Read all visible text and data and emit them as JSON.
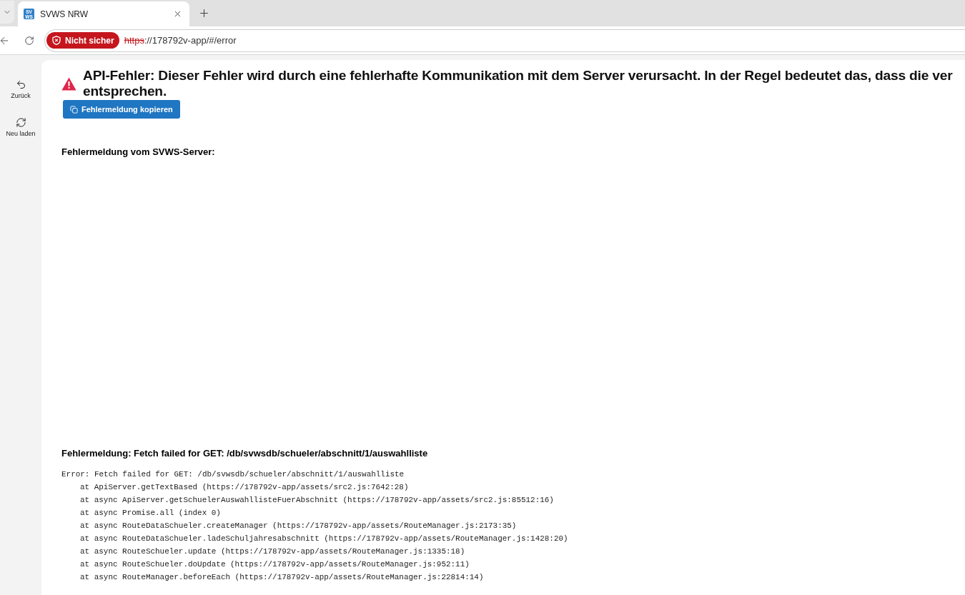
{
  "browser": {
    "tabs": [
      {
        "title": "SVWS NRW",
        "favicon_text": "SV WS",
        "selected": true
      }
    ],
    "address_bar": {
      "security_label": "Nicht sicher",
      "secure": false,
      "scheme": "https",
      "url_rest": "://178792v-app/#/error"
    }
  },
  "sidebar": {
    "items": [
      {
        "kind": "back",
        "label": "Zurück"
      },
      {
        "kind": "reload",
        "label": "Neu laden"
      }
    ]
  },
  "error_page": {
    "heading_lines": [
      "API-Fehler: Dieser Fehler wird durch eine fehlerhafte Kommunikation mit dem Server verursacht. In der Regel bedeutet das, dass die ver",
      "entsprechen."
    ],
    "copy_button": "Fehlermeldung kopieren",
    "server_message_title": "Fehlermeldung vom SVWS-Server:",
    "message_title": "Fehlermeldung: Fetch failed for GET: /db/svwsdb/schueler/abschnitt/1/auswahlliste",
    "stack": {
      "message": "Error: Fetch failed for GET: /db/svwsdb/schueler/abschnitt/1/auswahlliste",
      "frames": [
        "at ApiServer.getTextBased (https://178792v-app/assets/src2.js:7642:28)",
        "at async ApiServer.getSchuelerAuswahllisteFuerAbschnitt (https://178792v-app/assets/src2.js:85512:16)",
        "at async Promise.all (index 0)",
        "at async RouteDataSchueler.createManager (https://178792v-app/assets/RouteManager.js:2173:35)",
        "at async RouteDataSchueler.ladeSchuljahresabschnitt (https://178792v-app/assets/RouteManager.js:1428:20)",
        "at async RouteSchueler.update (https://178792v-app/assets/RouteManager.js:1335:18)",
        "at async RouteSchueler.doUpdate (https://178792v-app/assets/RouteManager.js:952:11)",
        "at async RouteManager.beforeEach (https://178792v-app/assets/RouteManager.js:22814:14)"
      ]
    }
  }
}
